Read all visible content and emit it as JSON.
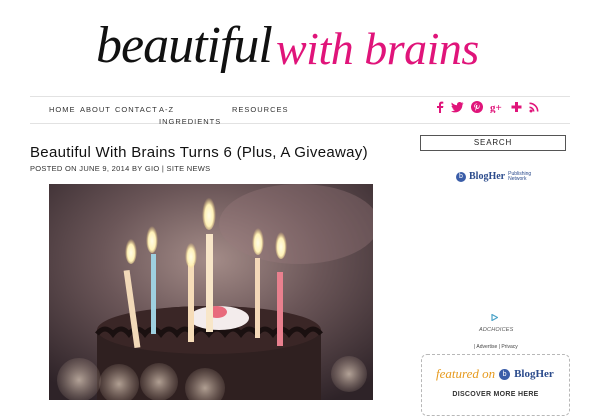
{
  "site": {
    "logo_part1": "beautiful",
    "logo_part2": "with brains"
  },
  "nav": {
    "items": [
      "HOME",
      "ABOUT",
      "CONTACT",
      "A-Z INGREDIENTS",
      "RESOURCES"
    ]
  },
  "social": {
    "icons": [
      "facebook-icon",
      "twitter-icon",
      "pinterest-icon",
      "google-plus-icon",
      "bloglovin-icon",
      "rss-icon"
    ],
    "glyphs": [
      "f",
      "🐦",
      "℗",
      "g+",
      "✚",
      "◉"
    ],
    "color": "#e0147a"
  },
  "post": {
    "title": "Beautiful With Brains Turns 6 (Plus, A Giveaway)",
    "meta_prefix": "POSTED ON",
    "date": "JUNE 9, 2014",
    "by": "BY",
    "author": "GIO",
    "separator": "|",
    "category": "SITE NEWS"
  },
  "sidebar": {
    "search_label": "SEARCH",
    "blogher_name": "BlogHer",
    "blogher_sub": "Publishing Network",
    "adchoices": "ADCHOICES",
    "ad_links": "| Advertise | Privacy",
    "featured_word": "featured on",
    "featured_name": "BlogHer",
    "discover": "DISCOVER MORE HERE"
  },
  "colors": {
    "accent": "#e0147a",
    "blogher_blue": "#2b4b8c",
    "featured_orange": "#e69a1e"
  }
}
